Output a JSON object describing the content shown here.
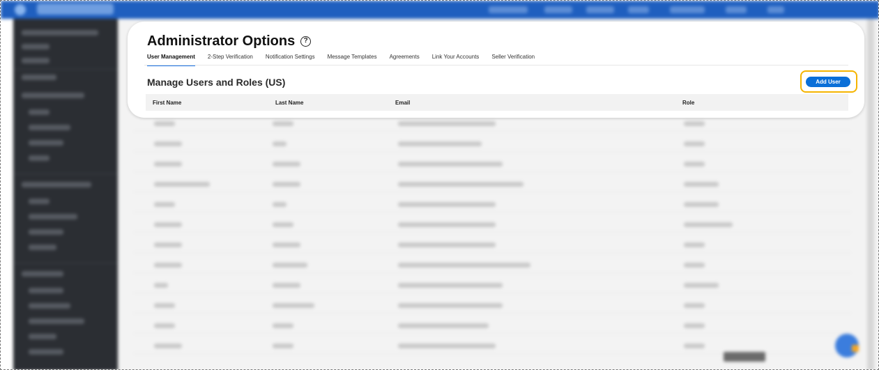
{
  "page": {
    "title": "Administrator Options",
    "help_icon": "question-circle-icon"
  },
  "tabs": [
    {
      "label": "User Management",
      "active": true
    },
    {
      "label": "2-Step Verification",
      "active": false
    },
    {
      "label": "Notification Settings",
      "active": false
    },
    {
      "label": "Message Templates",
      "active": false
    },
    {
      "label": "Agreements",
      "active": false
    },
    {
      "label": "Link Your Accounts",
      "active": false
    },
    {
      "label": "Seller Verification",
      "active": false
    }
  ],
  "section": {
    "title": "Manage Users and Roles (US)",
    "add_user_label": "Add User"
  },
  "table": {
    "columns": [
      "First Name",
      "Last Name",
      "Email",
      "Role"
    ]
  },
  "colors": {
    "accent": "#0a6fd8",
    "highlight": "#f5b400",
    "topbar": "#1f5fbf",
    "sidebar": "#2b2e33"
  }
}
